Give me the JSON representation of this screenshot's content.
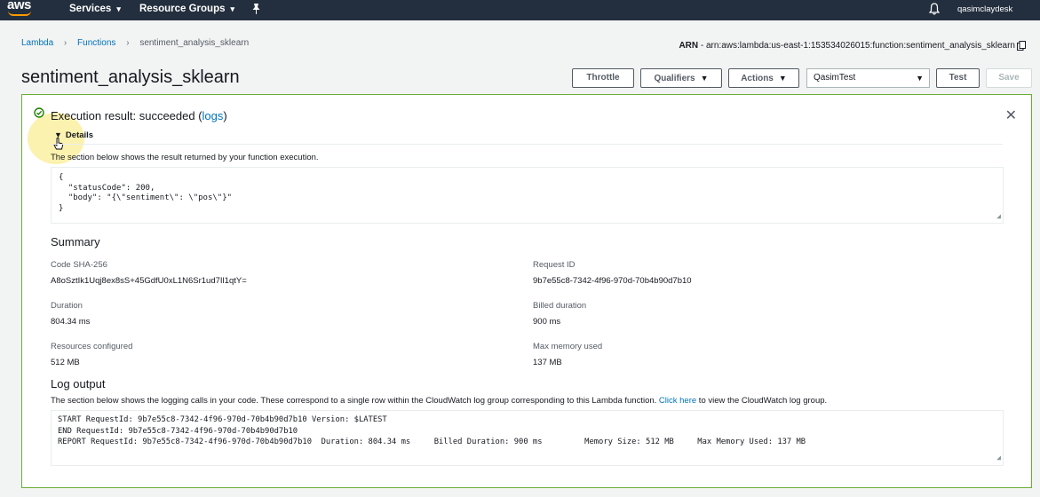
{
  "topnav": {
    "logo": "aws",
    "services": "Services",
    "resource_groups": "Resource Groups",
    "user": "qasimclaydesk"
  },
  "breadcrumb": {
    "lambda": "Lambda",
    "functions": "Functions",
    "current": "sentiment_analysis_sklearn"
  },
  "arn": {
    "label": "ARN",
    "value": "- arn:aws:lambda:us-east-1:153534026015:function:sentiment_analysis_sklearn"
  },
  "page": {
    "title": "sentiment_analysis_sklearn"
  },
  "toolbar": {
    "throttle": "Throttle",
    "qualifiers": "Qualifiers",
    "actions": "Actions",
    "test_event": "QasimTest",
    "test": "Test",
    "save": "Save"
  },
  "result": {
    "status_text": "Execution result: succeeded (",
    "logs_link": "logs",
    "status_close": ")",
    "details_label": "Details",
    "description": "The section below shows the result returned by your function execution.",
    "output": "{\n  \"statusCode\": 200,\n  \"body\": \"{\\\"sentiment\\\": \\\"pos\\\"}\"\n}"
  },
  "summary": {
    "title": "Summary",
    "code_sha_label": "Code SHA-256",
    "code_sha_value": "A8oSztIk1Uqj8ex8sS+45GdfU0xL1N6Sr1ud7Il1qtY=",
    "request_id_label": "Request ID",
    "request_id_value": "9b7e55c8-7342-4f96-970d-70b4b90d7b10",
    "duration_label": "Duration",
    "duration_value": "804.34 ms",
    "billed_label": "Billed duration",
    "billed_value": "900 ms",
    "resources_label": "Resources configured",
    "resources_value": "512 MB",
    "max_memory_label": "Max memory used",
    "max_memory_value": "137 MB"
  },
  "log": {
    "title": "Log output",
    "desc_before": "The section below shows the logging calls in your code. These correspond to a single row within the CloudWatch log group corresponding to this Lambda function. ",
    "click_here": "Click here",
    "desc_after": " to view the CloudWatch log group.",
    "output": "START RequestId: 9b7e55c8-7342-4f96-970d-70b4b90d7b10 Version: $LATEST\nEND RequestId: 9b7e55c8-7342-4f96-970d-70b4b90d7b10\nREPORT RequestId: 9b7e55c8-7342-4f96-970d-70b4b90d7b10  Duration: 804.34 ms     Billed Duration: 900 ms         Memory Size: 512 MB     Max Memory Used: 137 MB"
  },
  "colors": {
    "nav_bg": "#232f3e",
    "success_border": "#6aaf35",
    "link": "#0073bb"
  }
}
